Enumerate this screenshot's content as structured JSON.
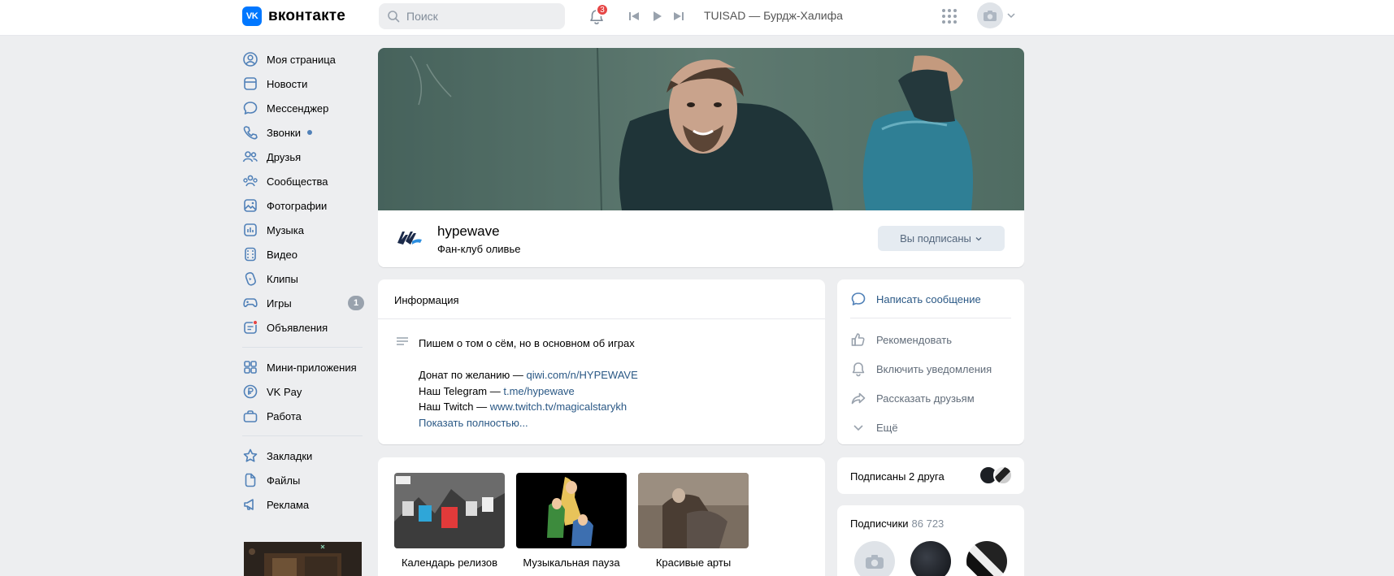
{
  "header": {
    "logo_mark": "VK",
    "logo_text": "вконтакте",
    "search_placeholder": "Поиск",
    "notifications_count": "3",
    "now_playing": "TUISAD — Бурдж-Халифа"
  },
  "sidebar": {
    "items": [
      {
        "label": "Моя страница",
        "icon": "user-circle-icon"
      },
      {
        "label": "Новости",
        "icon": "news-icon"
      },
      {
        "label": "Мессенджер",
        "icon": "message-icon"
      },
      {
        "label": "Звонки",
        "icon": "phone-icon"
      },
      {
        "label": "Друзья",
        "icon": "friends-icon"
      },
      {
        "label": "Сообщества",
        "icon": "communities-icon"
      },
      {
        "label": "Фотографии",
        "icon": "photo-icon"
      },
      {
        "label": "Музыка",
        "icon": "music-icon"
      },
      {
        "label": "Видео",
        "icon": "video-icon"
      },
      {
        "label": "Клипы",
        "icon": "clips-icon"
      },
      {
        "label": "Игры",
        "icon": "gamepad-icon",
        "count": "1"
      },
      {
        "label": "Объявления",
        "icon": "classifieds-icon"
      }
    ],
    "items2": [
      {
        "label": "Мини-приложения",
        "icon": "apps-icon"
      },
      {
        "label": "VK Pay",
        "icon": "vkpay-icon"
      },
      {
        "label": "Работа",
        "icon": "briefcase-icon"
      }
    ],
    "items3": [
      {
        "label": "Закладки",
        "icon": "star-icon"
      },
      {
        "label": "Файлы",
        "icon": "file-icon"
      },
      {
        "label": "Реклама",
        "icon": "megaphone-icon"
      }
    ]
  },
  "group": {
    "name": "hypewave",
    "status": "Фан-клуб оливье",
    "subscribe_button": "Вы подписаны"
  },
  "info": {
    "title": "Информация",
    "line1": "Пишем о том о сём, но в основном об играх",
    "donate_prefix": "Донат по желанию — ",
    "donate_link": "qiwi.com/n/HYPEWAVE",
    "telegram_prefix": "Наш Telegram — ",
    "telegram_link": "t.me/hypewave",
    "twitch_prefix": "Наш Twitch — ",
    "twitch_link": "www.twitch.tv/magicalstarykh",
    "show_more": "Показать полностью..."
  },
  "albums": [
    {
      "title": "Календарь релизов"
    },
    {
      "title": "Музыкальная пауза"
    },
    {
      "title": "Красивые арты"
    }
  ],
  "actions": {
    "message": "Написать сообщение",
    "recommend": "Рекомендовать",
    "notify": "Включить уведомления",
    "share": "Рассказать друзьям",
    "more": "Ещё"
  },
  "friends": {
    "text": "Подписаны 2 друга"
  },
  "subscribers": {
    "title": "Подписчики",
    "count": "86 723"
  },
  "colors": {
    "accent": "#0077ff",
    "link": "#2a5885",
    "background": "#edeef0"
  }
}
